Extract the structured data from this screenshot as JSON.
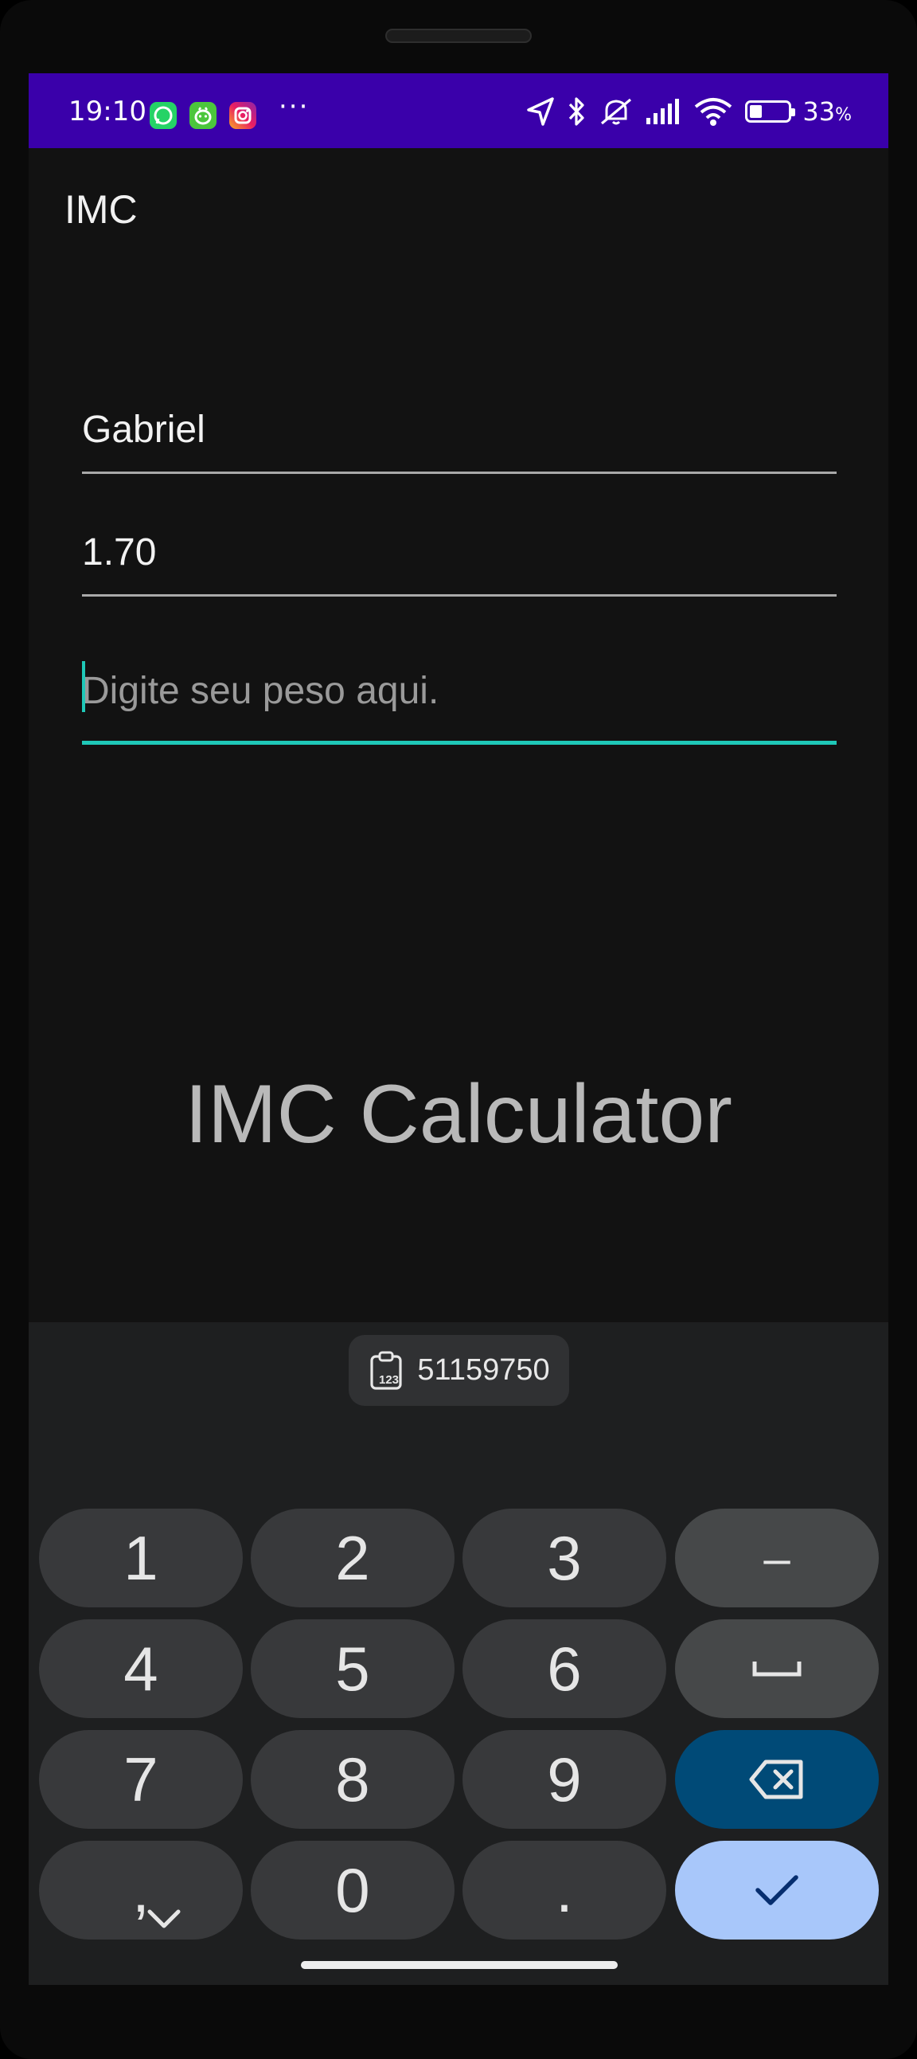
{
  "status_bar": {
    "time": "19:10",
    "notification_icons": [
      "whatsapp-icon",
      "fruit-app-icon",
      "instagram-icon"
    ],
    "more_indicator": "···",
    "battery_percent": "33",
    "battery_suffix": "%",
    "battery_level": 0.33,
    "colors": {
      "background": "#3a00aa"
    }
  },
  "app_bar": {
    "title": "IMC"
  },
  "form": {
    "name": {
      "value": "Gabriel"
    },
    "height": {
      "value": "1.70"
    },
    "weight": {
      "value": "",
      "placeholder": "Digite seu peso aqui."
    }
  },
  "main": {
    "title": "IMC Calculator"
  },
  "keyboard": {
    "clipboard_suggestion": "51159750",
    "rows": [
      [
        "1",
        "2",
        "3",
        "–"
      ],
      [
        "4",
        "5",
        "6",
        "space"
      ],
      [
        "7",
        "8",
        "9",
        "backspace"
      ],
      [
        ",",
        "0",
        ".",
        "done"
      ]
    ],
    "keys": {
      "k1": "1",
      "k2": "2",
      "k3": "3",
      "dash": "–",
      "k4": "4",
      "k5": "5",
      "k6": "6",
      "k7": "7",
      "k8": "8",
      "k9": "9",
      "comma": ",",
      "k0": "0",
      "period": "."
    },
    "colors": {
      "done": "#a8c7fa",
      "backspace": "#004a77",
      "accent": "#1fc8b8"
    }
  }
}
